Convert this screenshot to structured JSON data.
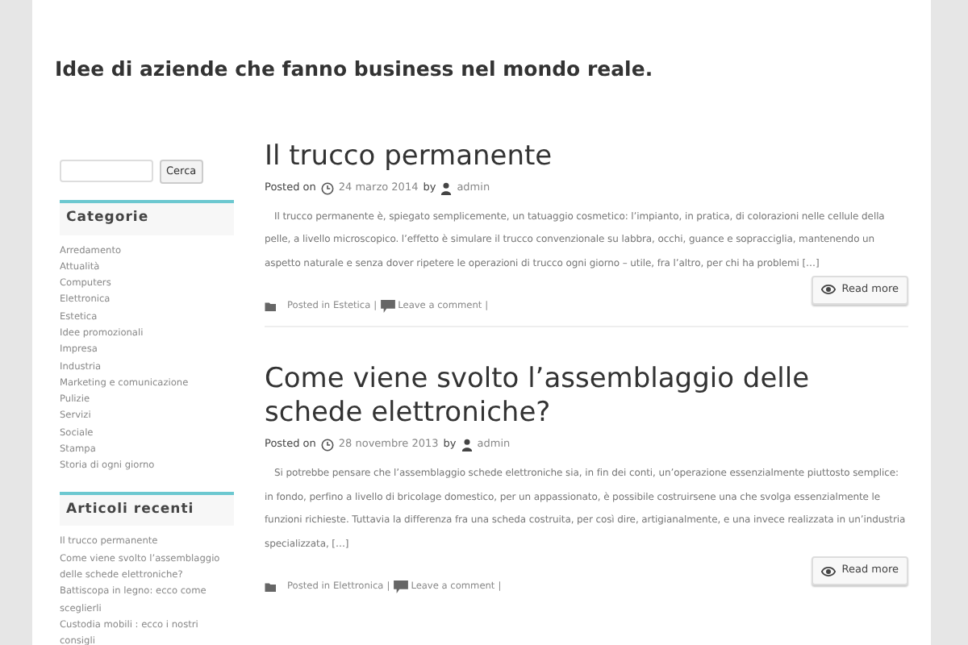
{
  "site": {
    "title": "Idee di aziende che fanno business nel mondo reale."
  },
  "sidebar": {
    "search": {
      "button": "Cerca"
    },
    "widgets": [
      {
        "title": "Categorie",
        "items": [
          "Arredamento",
          "Attualità",
          "Computers",
          "Elettronica",
          "Estetica",
          "Idee promozionali",
          "Impresa",
          "Industria",
          "Marketing e comunicazione",
          "Pulizie",
          "Servizi",
          "Sociale",
          "Stampa",
          "Storia di ogni giorno"
        ]
      },
      {
        "title": "Articoli recenti",
        "items": [
          "Il trucco permanente",
          "Come viene svolto l’assemblaggio delle schede elettroniche?",
          "Battiscopa in legno: ecco come sceglierli",
          "Custodia mobili : ecco i nostri consigli"
        ]
      }
    ]
  },
  "posts": [
    {
      "title": "Il trucco permanente",
      "posted_on": "Posted on",
      "date": "24 marzo 2014",
      "by": "by",
      "author": "admin",
      "excerpt": "Il trucco permanente è, spiegato semplicemente, un tatuaggio cosmetico: l’impianto, in pratica, di colorazioni nelle cellule della pelle, a livello microscopico. l’effetto è simulare il trucco convenzionale su labbra, occhi, guance e sopracciglia, mantenendo un aspetto naturale e senza dover ripetere le operazioni di trucco ogni giorno – utile, fra l’altro, per chi ha problemi […]",
      "read_more": "Read more",
      "posted_in": "Posted in",
      "category": "Estetica",
      "separator_1": "|",
      "comment_link": "Leave a comment",
      "separator_2": "|"
    },
    {
      "title": "Come viene svolto l’assemblaggio delle schede elettroniche?",
      "posted_on": "Posted on",
      "date": "28 novembre 2013",
      "by": "by",
      "author": "admin",
      "excerpt": "Si potrebbe pensare che l’assemblaggio schede elettroniche sia, in fin dei conti, un’operazione essenzialmente piuttosto semplice: in fondo, perfino a livello di bricolage domestico, per un appassionato, è possibile costruirsene una che svolga essenzialmente le funzioni richieste. Tuttavia la differenza fra una scheda costruita, per così dire, artigianalmente, e una invece realizzata in un’industria specializzata, […]",
      "read_more": "Read more",
      "posted_in": "Posted in",
      "category": "Elettronica",
      "separator_1": "|",
      "comment_link": "Leave a comment",
      "separator_2": "|"
    }
  ]
}
